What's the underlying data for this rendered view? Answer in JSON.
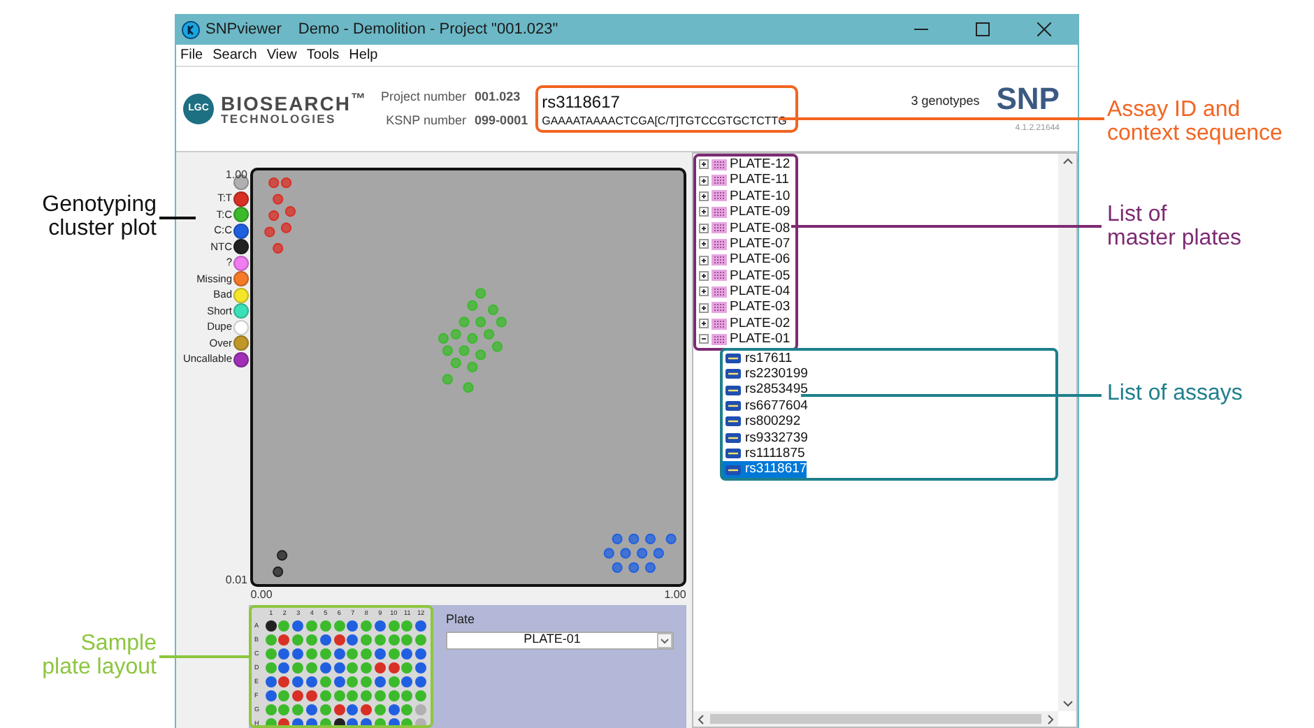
{
  "window": {
    "title": "SNPviewer",
    "subtitle": "Demo - Demolition - Project \"001.023\""
  },
  "menu": [
    "File",
    "Search",
    "View",
    "Tools",
    "Help"
  ],
  "header": {
    "logo_mark": "LGC",
    "brand": "BIOSEARCH$^{™}$",
    "brand_sub": "TECHNOLOGIES",
    "project_label": "Project number",
    "project_value": "001.023",
    "ksnp_label": "KSNP number",
    "ksnp_value": "099-0001",
    "assay_id": "rs3118617",
    "sequence": "GAAAATAAAACTCGA[C/T]TGTCCGTGCTCTTG",
    "genotypes": "3 genotypes",
    "product_logo": "SNP",
    "version": "4.1.2.21644"
  },
  "legend": [
    {
      "color": "#b0b0b0"
    },
    {
      "label": "T:T",
      "color": "#d93025"
    },
    {
      "label": "T:C",
      "color": "#3cba2c"
    },
    {
      "label": "C:C",
      "color": "#2060e0"
    },
    {
      "label": "NTC",
      "color": "#222222"
    },
    {
      "label": "?",
      "color": "#f07cf0"
    },
    {
      "label": "Missing",
      "color": "#f47a2a"
    },
    {
      "label": "Bad",
      "color": "#f5e62a"
    },
    {
      "label": "Short",
      "color": "#3ce0b8"
    },
    {
      "label": "Dupe",
      "color": "#ffffff"
    },
    {
      "label": "Over",
      "color": "#c0982a"
    },
    {
      "label": "Uncallable",
      "color": "#a030b8"
    }
  ],
  "plot": {
    "chart_data": {
      "type": "scatter",
      "xlim": [
        -0.027,
        1.027
      ],
      "ylim": [
        -0.007,
        1.017
      ],
      "xticks": [
        {
          "value": 0,
          "label": "0.00"
        },
        {
          "value": 1,
          "label": "1.00"
        }
      ],
      "yticks": [
        {
          "value": 0.01,
          "label": "0.01"
        },
        {
          "value": 1,
          "label": "1.00"
        }
      ],
      "series": [
        {
          "color": "#d93025",
          "x": [
            0.03,
            0.06,
            0.04,
            0.07,
            0.03,
            0.06,
            0.02,
            0.04
          ],
          "values": [
            0.98,
            0.98,
            0.94,
            0.91,
            0.9,
            0.87,
            0.86,
            0.82
          ]
        },
        {
          "color": "#3cba2c",
          "x": [
            0.45,
            0.49,
            0.53,
            0.57,
            0.47,
            0.51,
            0.55,
            0.58,
            0.49,
            0.53,
            0.56,
            0.51,
            0.53,
            0.47,
            0.51,
            0.44,
            0.5,
            0.45
          ],
          "values": [
            0.57,
            0.57,
            0.56,
            0.58,
            0.61,
            0.6,
            0.61,
            0.64,
            0.64,
            0.64,
            0.67,
            0.68,
            0.71,
            0.54,
            0.53,
            0.6,
            0.48,
            0.5
          ]
        },
        {
          "color": "#2060e0",
          "x": [
            0.86,
            0.9,
            0.94,
            0.84,
            0.88,
            0.92,
            0.96,
            0.86,
            0.9,
            0.94,
            0.99
          ],
          "values": [
            0.04,
            0.04,
            0.04,
            0.075,
            0.075,
            0.075,
            0.075,
            0.11,
            0.11,
            0.11,
            0.11
          ]
        },
        {
          "color": "#222222",
          "x": [
            0.05,
            0.04
          ],
          "values": [
            0.07,
            0.03
          ]
        }
      ]
    }
  },
  "plate_layout": {
    "columns": [
      "1",
      "2",
      "3",
      "4",
      "5",
      "6",
      "7",
      "8",
      "9",
      "10",
      "11",
      "12"
    ],
    "rows": [
      {
        "label": "A",
        "wells": [
          {
            "color": "#222222"
          },
          {
            "color": "#3cba2c"
          },
          {
            "color": "#2060e0"
          },
          {
            "color": "#3cba2c"
          },
          {
            "color": "#3cba2c"
          },
          {
            "color": "#3cba2c"
          },
          {
            "color": "#2060e0"
          },
          {
            "color": "#3cba2c"
          },
          {
            "color": "#2060e0"
          },
          {
            "color": "#3cba2c"
          },
          {
            "color": "#3cba2c"
          },
          {
            "color": "#2060e0"
          }
        ]
      },
      {
        "label": "B",
        "wells": [
          {
            "color": "#3cba2c"
          },
          {
            "color": "#d93025"
          },
          {
            "color": "#3cba2c"
          },
          {
            "color": "#3cba2c"
          },
          {
            "color": "#2060e0"
          },
          {
            "color": "#d93025"
          },
          {
            "color": "#2060e0"
          },
          {
            "color": "#3cba2c"
          },
          {
            "color": "#3cba2c"
          },
          {
            "color": "#3cba2c"
          },
          {
            "color": "#3cba2c"
          },
          {
            "color": "#3cba2c"
          }
        ]
      },
      {
        "label": "C",
        "wells": [
          {
            "color": "#3cba2c"
          },
          {
            "color": "#2060e0"
          },
          {
            "color": "#2060e0"
          },
          {
            "color": "#3cba2c"
          },
          {
            "color": "#3cba2c"
          },
          {
            "color": "#2060e0"
          },
          {
            "color": "#3cba2c"
          },
          {
            "color": "#3cba2c"
          },
          {
            "color": "#2060e0"
          },
          {
            "color": "#3cba2c"
          },
          {
            "color": "#2060e0"
          },
          {
            "color": "#2060e0"
          }
        ]
      },
      {
        "label": "D",
        "wells": [
          {
            "color": "#3cba2c"
          },
          {
            "color": "#2060e0"
          },
          {
            "color": "#3cba2c"
          },
          {
            "color": "#3cba2c"
          },
          {
            "color": "#2060e0"
          },
          {
            "color": "#2060e0"
          },
          {
            "color": "#3cba2c"
          },
          {
            "color": "#3cba2c"
          },
          {
            "color": "#d93025"
          },
          {
            "color": "#d93025"
          },
          {
            "color": "#3cba2c"
          },
          {
            "color": "#2060e0"
          }
        ]
      },
      {
        "label": "E",
        "wells": [
          {
            "color": "#2060e0"
          },
          {
            "color": "#d93025"
          },
          {
            "color": "#2060e0"
          },
          {
            "color": "#2060e0"
          },
          {
            "color": "#3cba2c"
          },
          {
            "color": "#2060e0"
          },
          {
            "color": "#3cba2c"
          },
          {
            "color": "#3cba2c"
          },
          {
            "color": "#2060e0"
          },
          {
            "color": "#3cba2c"
          },
          {
            "color": "#2060e0"
          },
          {
            "color": "#2060e0"
          }
        ]
      },
      {
        "label": "F",
        "wells": [
          {
            "color": "#2060e0"
          },
          {
            "color": "#3cba2c"
          },
          {
            "color": "#d93025"
          },
          {
            "color": "#d93025"
          },
          {
            "color": "#3cba2c"
          },
          {
            "color": "#3cba2c"
          },
          {
            "color": "#3cba2c"
          },
          {
            "color": "#3cba2c"
          },
          {
            "color": "#3cba2c"
          },
          {
            "color": "#3cba2c"
          },
          {
            "color": "#3cba2c"
          },
          {
            "color": "#3cba2c"
          }
        ]
      },
      {
        "label": "G",
        "wells": [
          {
            "color": "#3cba2c"
          },
          {
            "color": "#3cba2c"
          },
          {
            "color": "#3cba2c"
          },
          {
            "color": "#2060e0"
          },
          {
            "color": "#3cba2c"
          },
          {
            "color": "#d93025"
          },
          {
            "color": "#2060e0"
          },
          {
            "color": "#d93025"
          },
          {
            "color": "#3cba2c"
          },
          {
            "color": "#2060e0"
          },
          {
            "color": "#3cba2c"
          },
          {
            "color": "#b0b0b0"
          }
        ]
      },
      {
        "label": "H",
        "wells": [
          {
            "color": "#3cba2c"
          },
          {
            "color": "#d93025"
          },
          {
            "color": "#2060e0"
          },
          {
            "color": "#2060e0"
          },
          {
            "color": "#3cba2c"
          },
          {
            "color": "#222222"
          },
          {
            "color": "#2060e0"
          },
          {
            "color": "#2060e0"
          },
          {
            "color": "#3cba2c"
          },
          {
            "color": "#2060e0"
          },
          {
            "color": "#3cba2c"
          },
          {
            "color": "#b0b0b0"
          }
        ]
      }
    ],
    "plate_label": "Plate",
    "plate_value": "PLATE-01"
  },
  "tree": [
    {
      "label": "PLATE-12",
      "expanded": false
    },
    {
      "label": "PLATE-11",
      "expanded": false
    },
    {
      "label": "PLATE-10",
      "expanded": false
    },
    {
      "label": "PLATE-09",
      "expanded": false
    },
    {
      "label": "PLATE-08",
      "expanded": false
    },
    {
      "label": "PLATE-07",
      "expanded": false
    },
    {
      "label": "PLATE-06",
      "expanded": false
    },
    {
      "label": "PLATE-05",
      "expanded": false
    },
    {
      "label": "PLATE-04",
      "expanded": false
    },
    {
      "label": "PLATE-03",
      "expanded": false
    },
    {
      "label": "PLATE-02",
      "expanded": false
    },
    {
      "label": "PLATE-01",
      "expanded": true,
      "children": [
        {
          "label": "rs17611",
          "selected": false
        },
        {
          "label": "rs2230199",
          "selected": false
        },
        {
          "label": "rs2853495",
          "selected": false
        },
        {
          "label": "rs6677604",
          "selected": false
        },
        {
          "label": "rs800292",
          "selected": false
        },
        {
          "label": "rs9332739",
          "selected": false
        },
        {
          "label": "rs1111875",
          "selected": false
        },
        {
          "label": "rs3118617",
          "selected": true
        }
      ]
    }
  ],
  "annotations": [
    {
      "kind": "assay",
      "lines": [
        "Assay ID and",
        "context sequence"
      ],
      "color": "#f26522"
    },
    {
      "kind": "plot",
      "lines": [
        "Genotyping",
        "cluster plot"
      ],
      "color": "#111111"
    },
    {
      "kind": "plates",
      "lines": [
        "List of",
        "master plates"
      ],
      "color": "#7d2b73"
    },
    {
      "kind": "assays",
      "lines": [
        "List of assays"
      ],
      "color": "#1f7f8c"
    },
    {
      "kind": "layout",
      "lines": [
        "Sample",
        "plate layout"
      ],
      "color": "#8dc63f"
    }
  ]
}
